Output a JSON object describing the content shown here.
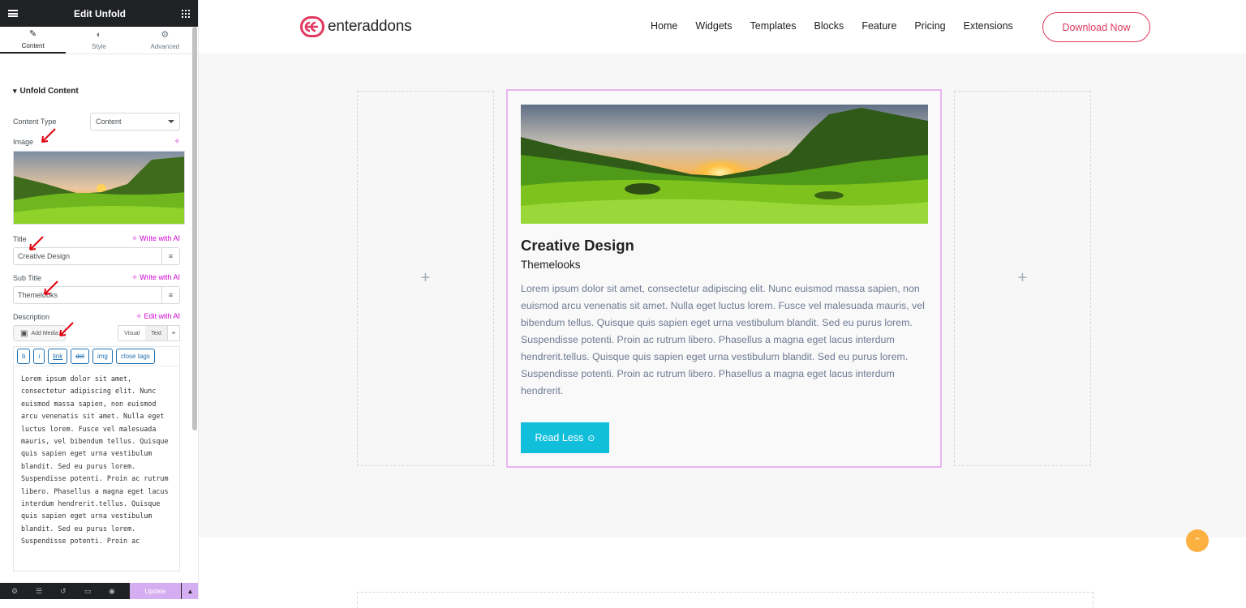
{
  "panel": {
    "title": "Edit Unfold",
    "tabs": [
      {
        "label": "Content",
        "icon": "pencil-icon"
      },
      {
        "label": "Style",
        "icon": "half-circle-icon"
      },
      {
        "label": "Advanced",
        "icon": "gear-icon"
      }
    ],
    "section_title": "Unfold Content",
    "content_type_label": "Content Type",
    "content_type_value": "Content",
    "image_label": "Image",
    "title_label": "Title",
    "title_value": "Creative Design",
    "subtitle_label": "Sub Title",
    "subtitle_value": "Themelooks",
    "description_label": "Description",
    "write_ai": "Write with AI",
    "edit_ai": "Edit with AI",
    "add_media": "Add Media",
    "visual_tab": "Visual",
    "text_tab": "Text",
    "quicktags": [
      "b",
      "i",
      "link",
      "del",
      "img",
      "close tags"
    ],
    "description_value": "Lorem ipsum dolor sit amet, consectetur adipiscing elit. Nunc euismod massa sapien, non euismod arcu venenatis sit amet. Nulla eget luctus lorem. Fusce vel malesuada mauris, vel bibendum tellus. Quisque quis sapien eget urna vestibulum blandit. Sed eu purus lorem. Suspendisse potenti. Proin ac rutrum libero. Phasellus a magna eget lacus interdum hendrerit.tellus. Quisque quis sapien eget urna vestibulum blandit. Sed eu purus lorem. Suspendisse potenti. Proin ac",
    "update_label": "Update"
  },
  "site": {
    "logo_text": "enteraddons",
    "menu": [
      "Home",
      "Widgets",
      "Templates",
      "Blocks",
      "Feature",
      "Pricing",
      "Extensions"
    ],
    "download_label": "Download Now"
  },
  "card": {
    "title": "Creative Design",
    "subtitle": "Themelooks",
    "description": "Lorem ipsum dolor sit amet, consectetur adipiscing elit. Nunc euismod massa sapien, non euismod arcu venenatis sit amet. Nulla eget luctus lorem. Fusce vel malesuada mauris, vel bibendum tellus. Quisque quis sapien eget urna vestibulum blandit. Sed eu purus lorem. Suspendisse potenti. Proin ac rutrum libero. Phasellus a magna eget lacus interdum hendrerit.tellus. Quisque quis sapien eget urna vestibulum blandit. Sed eu purus lorem. Suspendisse potenti. Proin ac rutrum libero. Phasellus a magna eget lacus interdum hendrerit.",
    "button_label": "Read Less"
  },
  "colors": {
    "brand": "#e2395f",
    "button": "#11bfdb",
    "card_border": "#e8b6ee",
    "ai_accent": "#d004d4"
  }
}
